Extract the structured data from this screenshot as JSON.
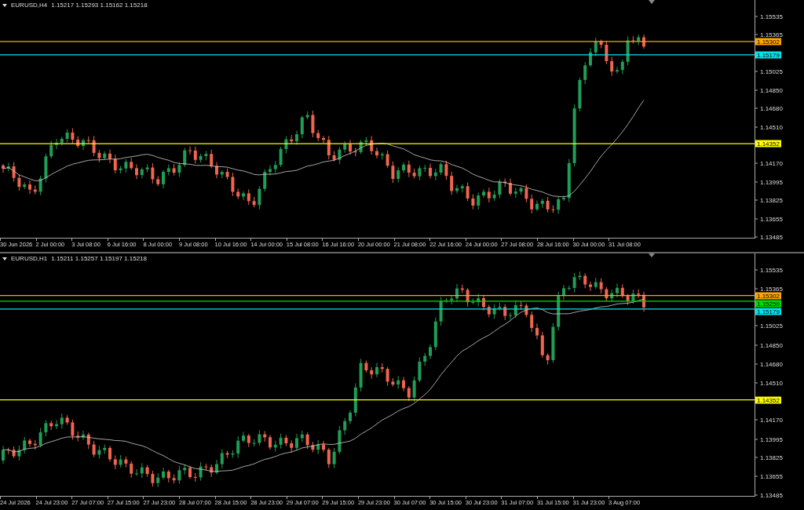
{
  "charts": [
    {
      "symbol": "EURUSD,H4",
      "ohlc": "1.15217 1.15293 1.15162 1.15218",
      "price_ticks": [
        "1.15535",
        "1.15365",
        "1.15025",
        "1.14850",
        "1.14680",
        "1.14510",
        "1.14170",
        "1.13995",
        "1.13825",
        "1.13655",
        "1.13485"
      ],
      "levels": [
        {
          "label": "1.15302",
          "color": "#ffa500"
        },
        {
          "label": "1.15179",
          "color": "#00e5ee"
        },
        {
          "label": "1.14352",
          "color": "#ffff00"
        }
      ],
      "time_labels": [
        "30 Jun 2026",
        "2 Jul 00:00",
        "3 Jul 08:00",
        "6 Jul 16:00",
        "8 Jul 00:00",
        "9 Jul 08:00",
        "10 Jul 16:00",
        "14 Jul 00:00",
        "15 Jul 08:00",
        "16 Jul 16:00",
        "20 Jul 00:00",
        "21 Jul 08:00",
        "22 Jul 16:00",
        "24 Jul 00:00",
        "27 Jul 08:00",
        "28 Jul 16:00",
        "30 Jul 00:00",
        "31 Jul 08:00"
      ]
    },
    {
      "symbol": "EURUSD,H1",
      "ohlc": "1.15211 1.15257 1.15197 1.15218",
      "price_ticks": [
        "1.15535",
        "1.15365",
        "1.15025",
        "1.14850",
        "1.14680",
        "1.14510",
        "1.14170",
        "1.13995",
        "1.13825",
        "1.13655",
        "1.13485"
      ],
      "levels": [
        {
          "label": "1.15302",
          "color": "#ffa500"
        },
        {
          "label": "1.15250",
          "color": "#00dd00"
        },
        {
          "label": "1.15179",
          "color": "#00e5ee"
        },
        {
          "label": "1.14352",
          "color": "#ffff00"
        }
      ],
      "time_labels": [
        "24 Jul 2026",
        "24 Jul 23:00",
        "27 Jul 07:00",
        "27 Jul 15:00",
        "27 Jul 23:00",
        "28 Jul 07:00",
        "28 Jul 15:00",
        "28 Jul 23:00",
        "29 Jul 07:00",
        "29 Jul 15:00",
        "29 Jul 23:00",
        "30 Jul 07:00",
        "30 Jul 15:00",
        "30 Jul 23:00",
        "31 Jul 07:00",
        "31 Jul 15:00",
        "31 Jul 23:00",
        "3 Aug 07:00"
      ]
    }
  ]
}
